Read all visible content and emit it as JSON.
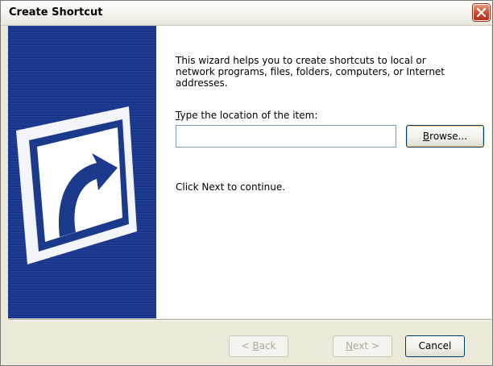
{
  "window": {
    "title": "Create Shortcut"
  },
  "banner": {
    "icon": "shortcut-arrow-icon",
    "background_color": "#1b3a8c"
  },
  "content": {
    "intro_text": "This wizard helps you to create shortcuts to local or network programs, files, folders, computers, or Internet addresses.",
    "location_label_mnemonic": "T",
    "location_label_rest": "ype the location of the item:",
    "location_value": "",
    "browse_mnemonic": "B",
    "browse_rest": "rowse...",
    "hint_text": "Click Next to continue."
  },
  "footer": {
    "back_prefix": "< ",
    "back_mnemonic": "B",
    "back_rest": "ack",
    "next_mnemonic": "N",
    "next_rest": "ext >",
    "cancel_label": "Cancel"
  },
  "colors": {
    "close_button": "#c8442a",
    "dialog_face": "#ece9d8"
  }
}
